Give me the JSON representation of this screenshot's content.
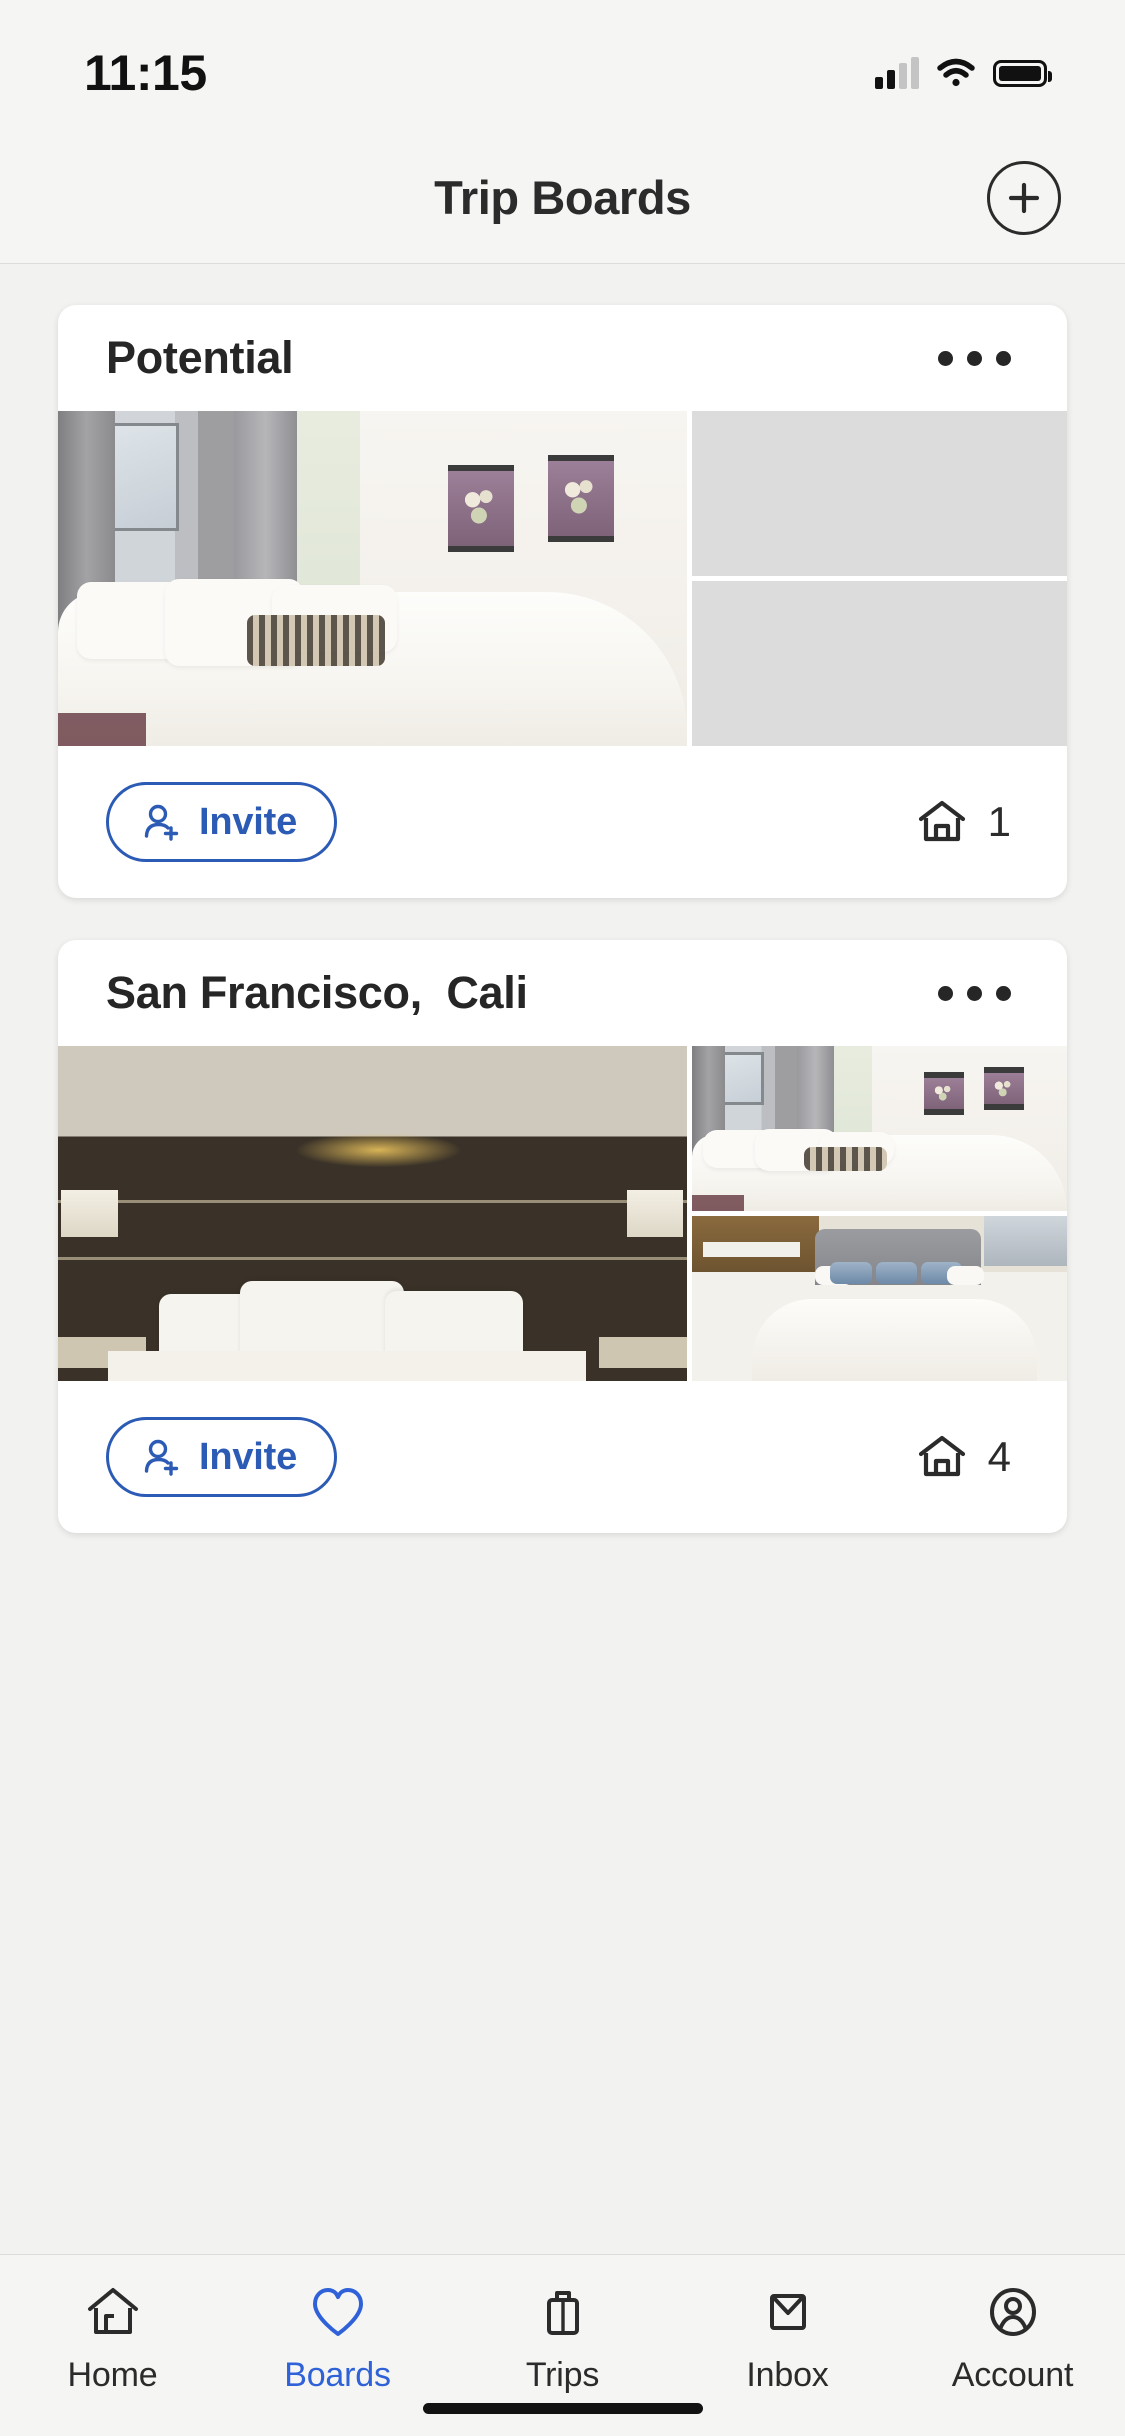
{
  "status_bar": {
    "time": "11:15",
    "cellular_icon": "cellular-signal-icon",
    "wifi_icon": "wifi-icon",
    "battery_icon": "battery-full-icon",
    "signal_bars_filled": 2,
    "signal_bars_total": 4
  },
  "header": {
    "title": "Trip Boards",
    "add_icon": "plus-circle-icon"
  },
  "boards": [
    {
      "title": "Potential",
      "menu_icon": "more-horizontal-icon",
      "invite_label": "Invite",
      "invite_icon": "person-add-icon",
      "property_icon": "house-icon",
      "property_count": "1",
      "photos": [
        {
          "name": "bright-bedroom-photo",
          "kind": "photo-bright-bedroom"
        },
        {
          "name": "photo-placeholder-top",
          "kind": "placeholder"
        },
        {
          "name": "photo-placeholder-bottom",
          "kind": "placeholder"
        }
      ]
    },
    {
      "title": "San Francisco,  Cali",
      "menu_icon": "more-horizontal-icon",
      "invite_label": "Invite",
      "invite_icon": "person-add-icon",
      "property_icon": "house-icon",
      "property_count": "4",
      "photos": [
        {
          "name": "dark-headboard-room-photo",
          "kind": "photo-dark-room"
        },
        {
          "name": "bright-bedroom-thumbnail",
          "kind": "photo-bright-bedroom"
        },
        {
          "name": "gray-headboard-room-thumbnail",
          "kind": "photo-gray-bed"
        }
      ]
    }
  ],
  "tabbar": {
    "items": [
      {
        "label": "Home",
        "icon": "house-icon",
        "active": false
      },
      {
        "label": "Boards",
        "icon": "heart-icon",
        "active": true
      },
      {
        "label": "Trips",
        "icon": "briefcase-icon",
        "active": false
      },
      {
        "label": "Inbox",
        "icon": "envelope-icon",
        "active": false
      },
      {
        "label": "Account",
        "icon": "person-circle-icon",
        "active": false
      }
    ]
  },
  "colors": {
    "accent_blue": "#2f62d8",
    "invite_blue": "#2c5bb5",
    "text_dark": "#2b2b2b",
    "page_background": "#f2f2f0",
    "card_background": "#ffffff",
    "placeholder_gray": "#dcdcdc"
  }
}
